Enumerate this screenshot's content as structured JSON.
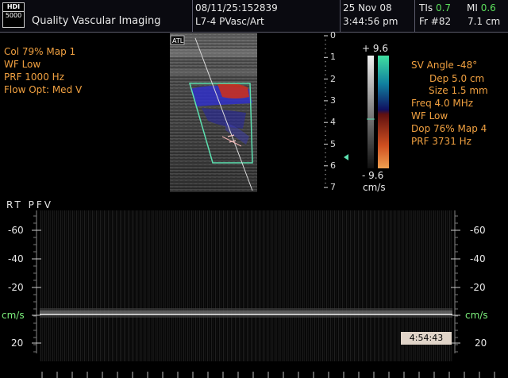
{
  "header": {
    "logo_top": "HDI",
    "logo_bottom": "5000",
    "institution": "Quality Vascular Imaging",
    "patient_id": "08/11/25:152839",
    "transducer": "L7-4 PVasc/Art",
    "date": "25 Nov 08",
    "time": "3:44:56 pm",
    "tis_label": "TIs",
    "tis_value": "0.7",
    "mi_label": "MI",
    "mi_value": "0.6",
    "frame": "Fr #82",
    "depth": "7.1 cm"
  },
  "color_settings": {
    "col_map": "Col 79%  Map 1",
    "wf": "WF Low",
    "prf": "PRF 1000  Hz",
    "flow_opt": "Flow Opt: Med V"
  },
  "doppler_settings": {
    "sv_angle": "SV Angle -48°",
    "dep": "Dep 5.0  cm",
    "size": "Size 1.5  mm",
    "freq": "Freq 4.0  MHz",
    "wf": "WF Low",
    "dop_map": "Dop 76%  Map 4",
    "prf": "PRF 3731  Hz"
  },
  "image": {
    "atl_label": "ATL"
  },
  "depth_scale": [
    "0",
    "1",
    "2",
    "3",
    "4",
    "5",
    "6",
    "7"
  ],
  "color_bar": {
    "top_value": "+ 9.6",
    "bottom_value": "- 9.6",
    "unit": "cm/s"
  },
  "spectral": {
    "label": "RT  PFV",
    "left_scale": [
      "-60",
      "-40",
      "-20",
      "cm/s",
      "20"
    ],
    "right_scale": [
      "-60",
      "-40",
      "-20",
      "cm/s",
      "20"
    ],
    "timestamp": "4:54:43"
  }
}
